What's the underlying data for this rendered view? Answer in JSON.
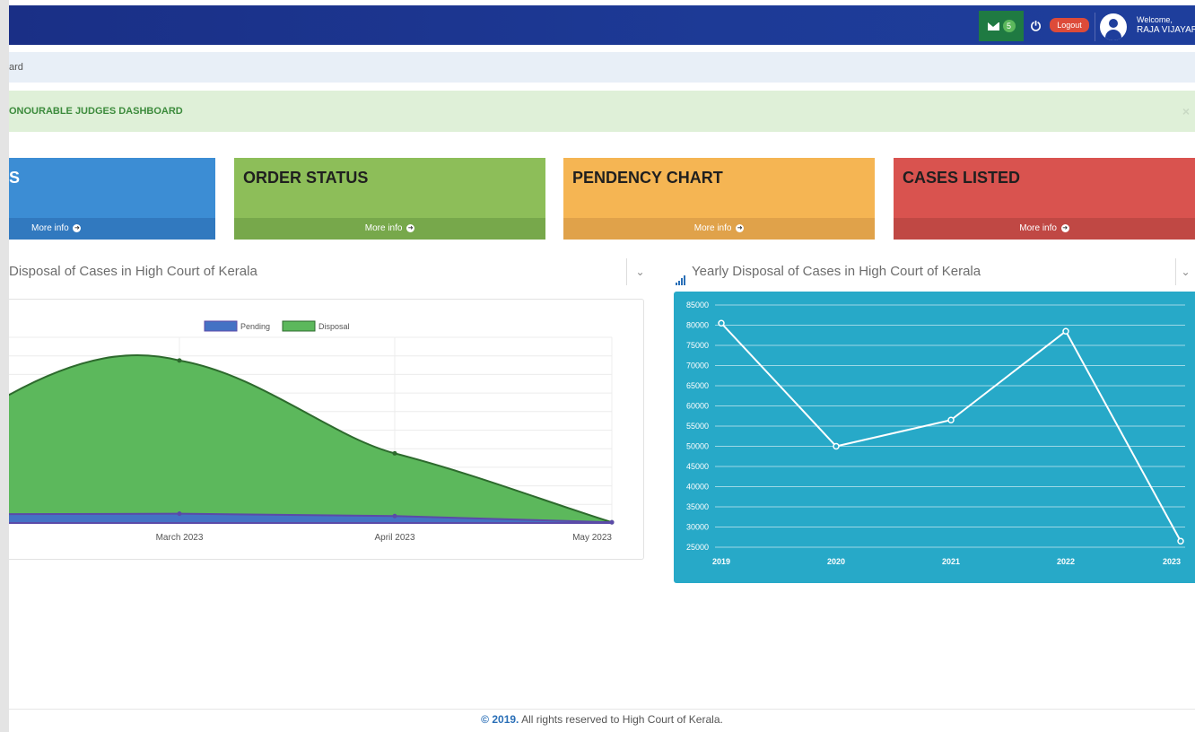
{
  "header": {
    "mail_count": "5",
    "logout_label": "Logout",
    "welcome_label": "Welcome,",
    "user_name": "RAJA VIJAYARA",
    "bg_color": "#1d3a96"
  },
  "breadcrumb": {
    "text": "ard"
  },
  "alert": {
    "text": "ONOURABLE JUDGES DASHBOARD",
    "close": "×"
  },
  "boxes": [
    {
      "title": "S",
      "more": "More info",
      "color": "#3c8dd4"
    },
    {
      "title": "ORDER STATUS",
      "more": "More info",
      "color": "#8dbe59"
    },
    {
      "title": "PENDENCY CHART",
      "more": "More info",
      "color": "#f5b553"
    },
    {
      "title": "CASES LISTED",
      "more": "More info",
      "color": "#d9534f"
    }
  ],
  "panels": {
    "left_title": "Disposal of Cases in High Court of Kerala",
    "right_title": "Yearly Disposal of Cases in High Court of Kerala",
    "chevron": "⌄"
  },
  "chart_data": [
    {
      "type": "area",
      "categories": [
        "March 2023",
        "April 2023",
        "May 2023"
      ],
      "series": [
        {
          "name": "Pending",
          "values": [
            400,
            300,
            30
          ],
          "color": "#4472c4"
        },
        {
          "name": "Disposal",
          "values": [
            7000,
            3000,
            30
          ],
          "color": "#5cb85c"
        }
      ],
      "legend": "top-center",
      "grid": true
    },
    {
      "type": "line",
      "categories": [
        "2019",
        "2020",
        "2021",
        "2022",
        "2023"
      ],
      "series": [
        {
          "values": [
            80500,
            50000,
            56500,
            78500,
            26500
          ],
          "color": "#ffffff"
        }
      ],
      "yticks": [
        25000,
        30000,
        35000,
        40000,
        45000,
        50000,
        55000,
        60000,
        65000,
        70000,
        75000,
        80000,
        85000
      ],
      "ylim": [
        25000,
        85000
      ],
      "grid": true,
      "background": "#27a9c8"
    }
  ],
  "footer": {
    "year": "© 2019.",
    "text": " All rights reserved to High Court of Kerala."
  }
}
